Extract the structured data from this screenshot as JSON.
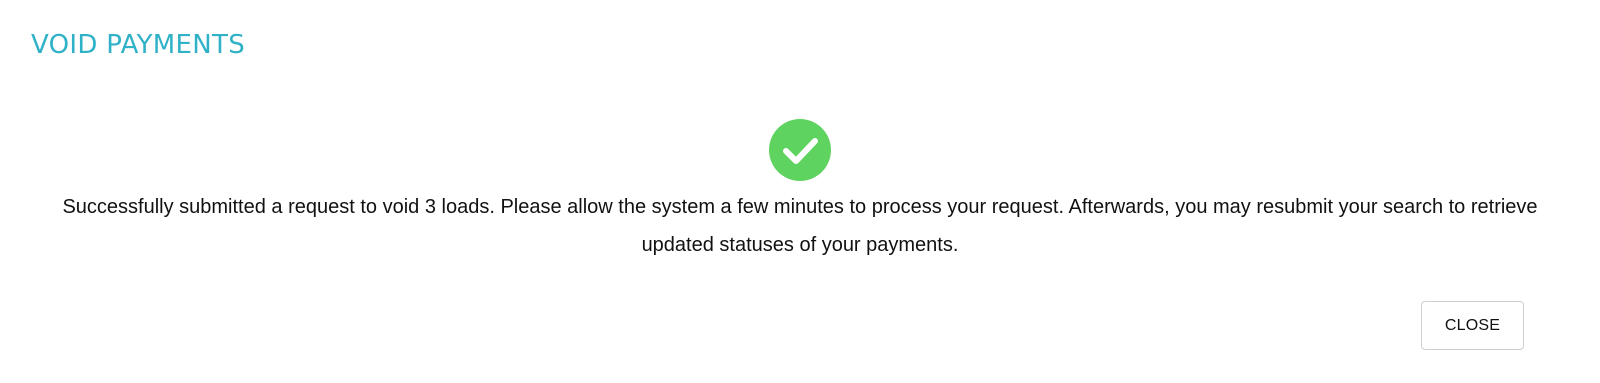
{
  "dialog": {
    "title": "VOID PAYMENTS",
    "status_icon": "check-circle-icon",
    "status_color": "#5fd35f",
    "title_color": "#2fb1c8",
    "message": "Successfully submitted a request to void 3 loads. Please allow the system a few minutes to process your request. Afterwards, you may resubmit your search to retrieve updated statuses of your payments.",
    "close_label": "CLOSE"
  }
}
